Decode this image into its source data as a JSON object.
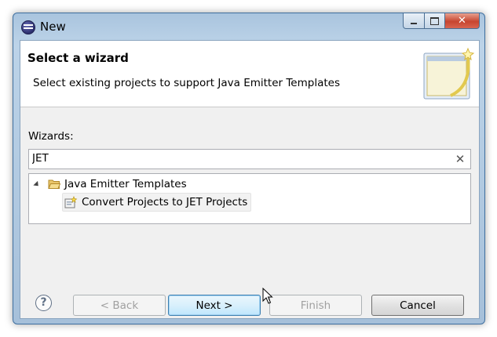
{
  "window": {
    "title": "New"
  },
  "header": {
    "title": "Select a wizard",
    "description": "Select existing projects to support Java Emitter Templates"
  },
  "wizards": {
    "label": "Wizards:",
    "filter_value": "JET",
    "clear_glyph": "✕",
    "tree": [
      {
        "label": "Java Emitter Templates",
        "expanded": true,
        "icon": "folder-open-icon"
      },
      {
        "label": "Convert Projects to JET Projects",
        "icon": "convert-wizard-icon"
      }
    ]
  },
  "buttons": {
    "help_glyph": "?",
    "back": "< Back",
    "next": "Next >",
    "finish": "Finish",
    "cancel": "Cancel"
  },
  "colors": {
    "frame": "#a9c4de",
    "close_button": "#c7452f",
    "default_button_border": "#3c7fb1"
  }
}
